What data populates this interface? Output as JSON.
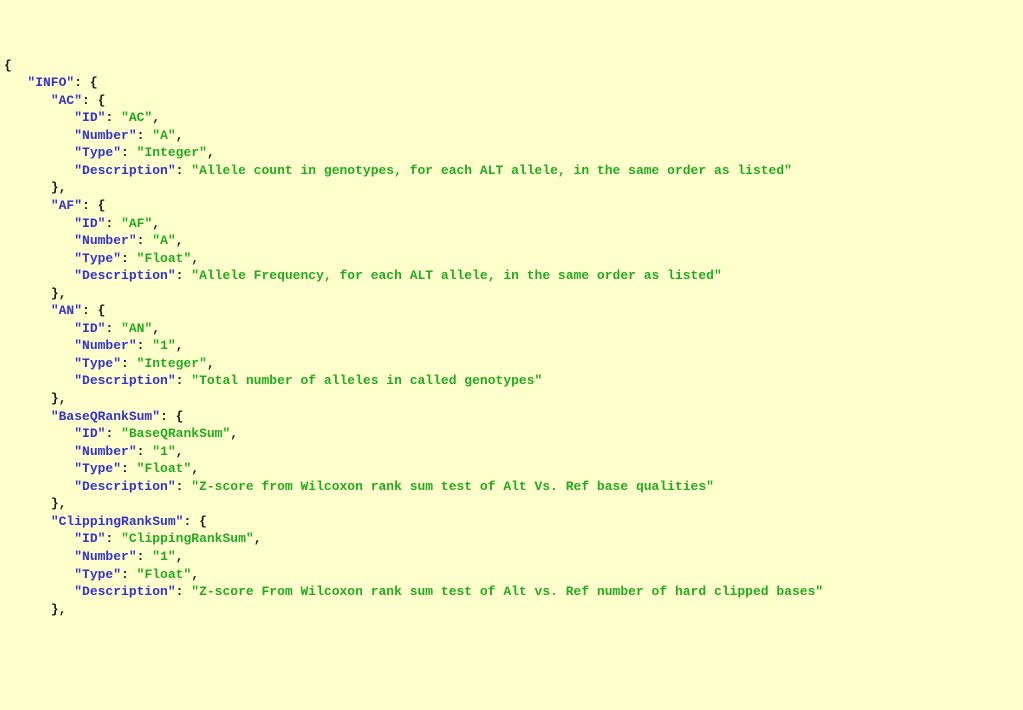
{
  "json": {
    "rootKey": "INFO",
    "sections": [
      {
        "key": "AC",
        "fields": {
          "ID": "AC",
          "Number": "A",
          "Type": "Integer",
          "Description": "Allele count in genotypes, for each ALT allele, in the same order as listed"
        }
      },
      {
        "key": "AF",
        "fields": {
          "ID": "AF",
          "Number": "A",
          "Type": "Float",
          "Description": "Allele Frequency, for each ALT allele, in the same order as listed"
        }
      },
      {
        "key": "AN",
        "fields": {
          "ID": "AN",
          "Number": "1",
          "Type": "Integer",
          "Description": "Total number of alleles in called genotypes"
        }
      },
      {
        "key": "BaseQRankSum",
        "fields": {
          "ID": "BaseQRankSum",
          "Number": "1",
          "Type": "Float",
          "Description": "Z-score from Wilcoxon rank sum test of Alt Vs. Ref base qualities"
        }
      },
      {
        "key": "ClippingRankSum",
        "fields": {
          "ID": "ClippingRankSum",
          "Number": "1",
          "Type": "Float",
          "Description": "Z-score From Wilcoxon rank sum test of Alt vs. Ref number of hard clipped bases"
        }
      }
    ]
  },
  "labels": {
    "ID": "ID",
    "Number": "Number",
    "Type": "Type",
    "Description": "Description"
  },
  "glyphs": {
    "openBrace": "{",
    "closeBrace": "}",
    "closeBraceComma": "},",
    "colon": ":",
    "comma": ",",
    "quote": "\""
  },
  "indent": "   "
}
